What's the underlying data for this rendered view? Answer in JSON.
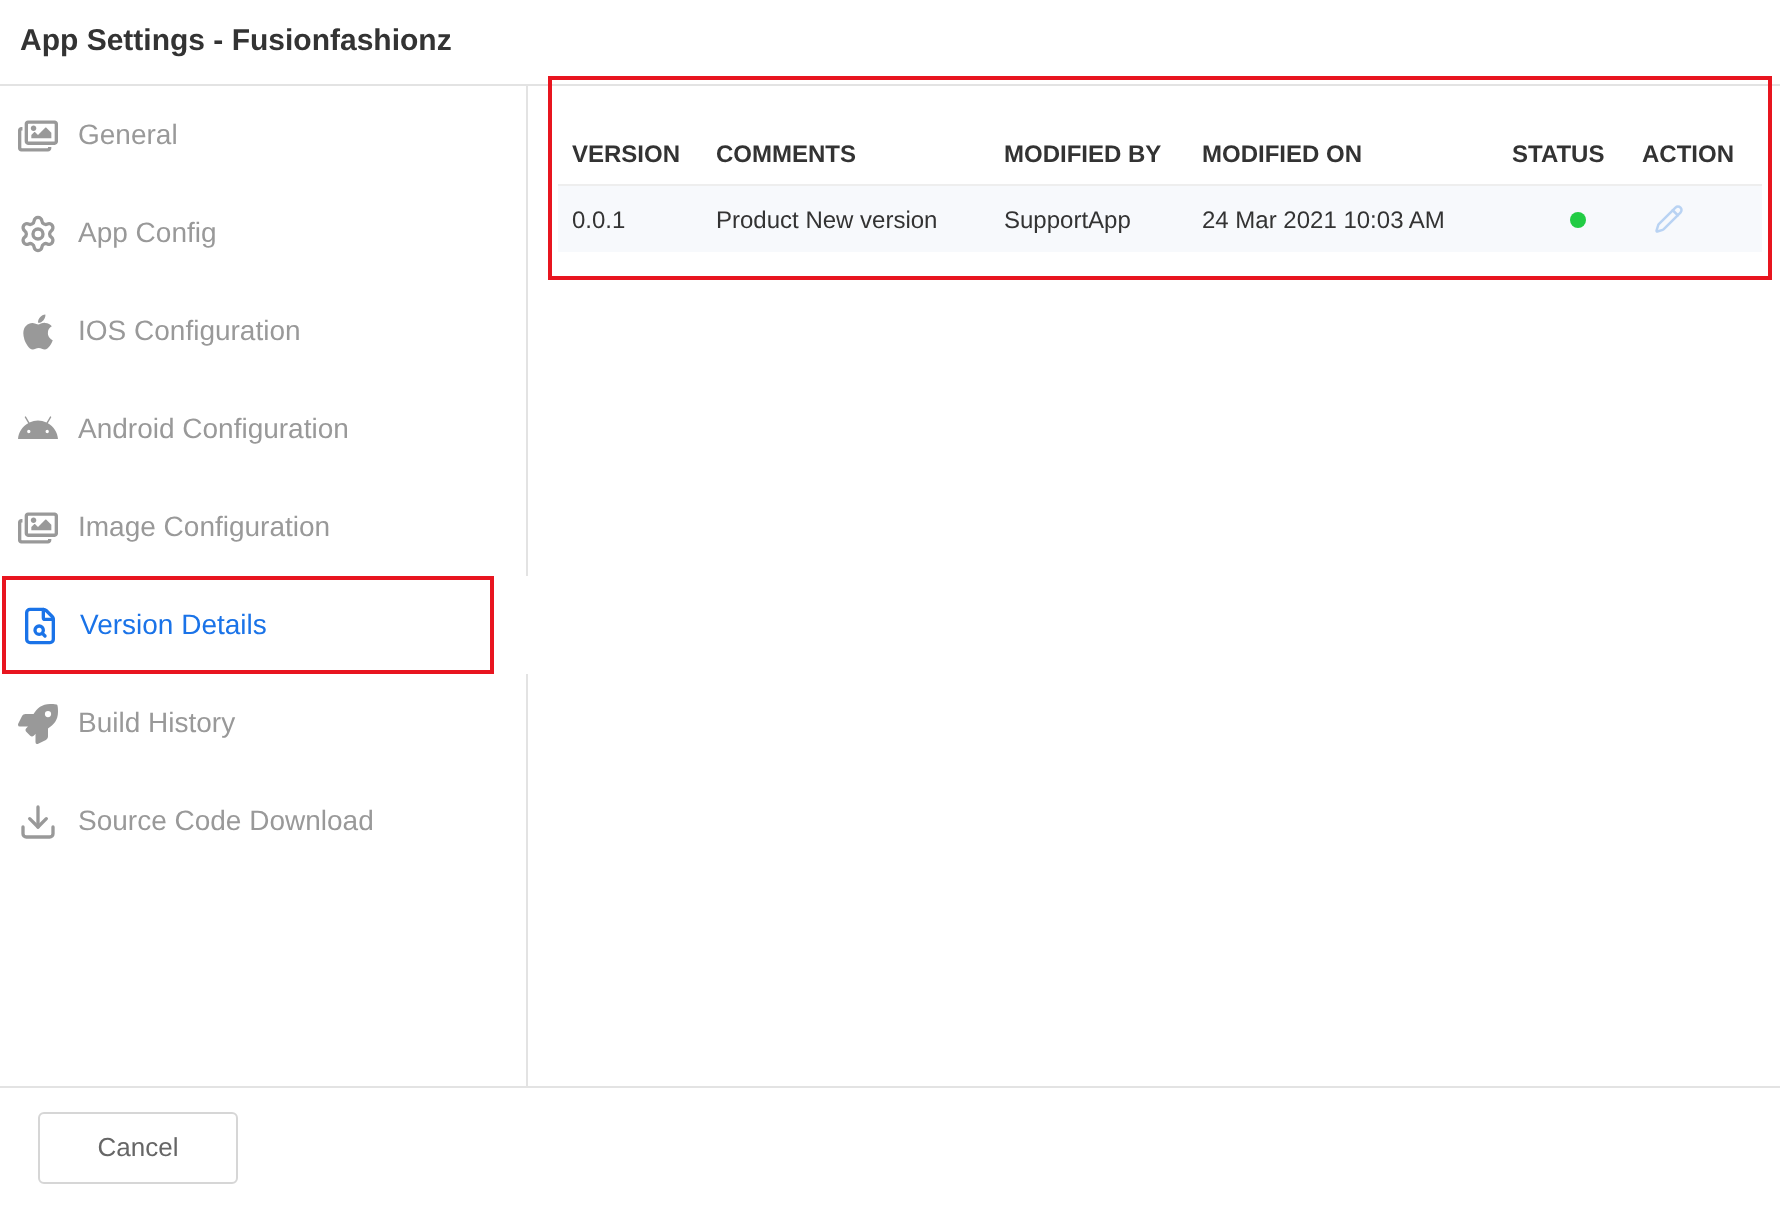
{
  "window": {
    "title": "App Settings - Fusionfashionz"
  },
  "sidebar": {
    "items": [
      {
        "label": "General",
        "selected": false,
        "highlighted": false
      },
      {
        "label": "App Config",
        "selected": false,
        "highlighted": false
      },
      {
        "label": "IOS Configuration",
        "selected": false,
        "highlighted": false
      },
      {
        "label": "Android Configuration",
        "selected": false,
        "highlighted": false
      },
      {
        "label": "Image Configuration",
        "selected": false,
        "highlighted": false
      },
      {
        "label": "Version Details",
        "selected": true,
        "highlighted": true
      },
      {
        "label": "Build History",
        "selected": false,
        "highlighted": false
      },
      {
        "label": "Source Code Download",
        "selected": false,
        "highlighted": false
      }
    ]
  },
  "table": {
    "highlighted": true,
    "columns": [
      "VERSION",
      "COMMENTS",
      "MODIFIED BY",
      "MODIFIED ON",
      "STATUS",
      "ACTION"
    ],
    "rows": [
      {
        "version": "0.0.1",
        "comments": "Product New version",
        "modified_by": "SupportApp",
        "modified_on": "24 Mar 2021 10:03 AM",
        "active": true
      }
    ]
  },
  "buttons": [
    {
      "label": "Cancel"
    }
  ]
}
